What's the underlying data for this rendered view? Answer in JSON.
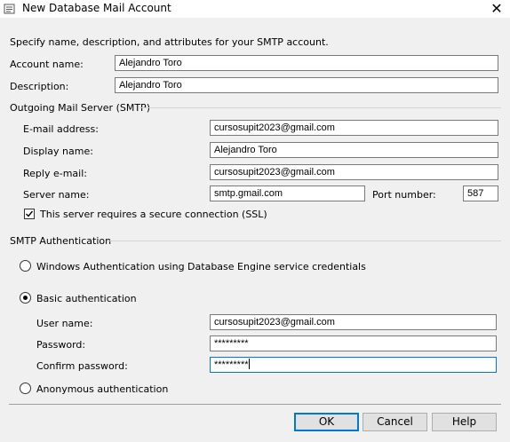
{
  "window": {
    "title": "New Database Mail Account",
    "close_glyph": "✕"
  },
  "intro": "Specify name, description, and attributes for your SMTP account.",
  "account": {
    "name_label": "Account name:",
    "name_value": "Alejandro Toro",
    "description_label": "Description:",
    "description_value": "Alejandro Toro"
  },
  "smtp_server": {
    "group_label": "Outgoing Mail Server (SMTP)",
    "email_label": "E-mail address:",
    "email_value": "cursosupit2023@gmail.com",
    "display_label": "Display name:",
    "display_value": "Alejandro Toro",
    "reply_label": "Reply e-mail:",
    "reply_value": "cursosupit2023@gmail.com",
    "server_label": "Server name:",
    "server_value": "smtp.gmail.com",
    "port_label": "Port number:",
    "port_value": "587",
    "ssl_label": "This server requires a secure connection (SSL)",
    "ssl_checked": true
  },
  "auth": {
    "group_label": "SMTP Authentication",
    "windows_label": "Windows Authentication using Database Engine service credentials",
    "basic_label": "Basic authentication",
    "selected": "basic",
    "username_label": "User name:",
    "username_value": "cursosupit2023@gmail.com",
    "password_label": "Password:",
    "password_value": "*********",
    "confirm_label": "Confirm password:",
    "confirm_value": "*********",
    "anonymous_label": "Anonymous authentication"
  },
  "buttons": {
    "ok": "OK",
    "cancel": "Cancel",
    "help": "Help"
  },
  "colors": {
    "focus": "#0078d7",
    "background": "#f0f0f0"
  },
  "icons": {
    "title_icon": "database-mail-icon",
    "checkbox_check": "check-icon"
  }
}
